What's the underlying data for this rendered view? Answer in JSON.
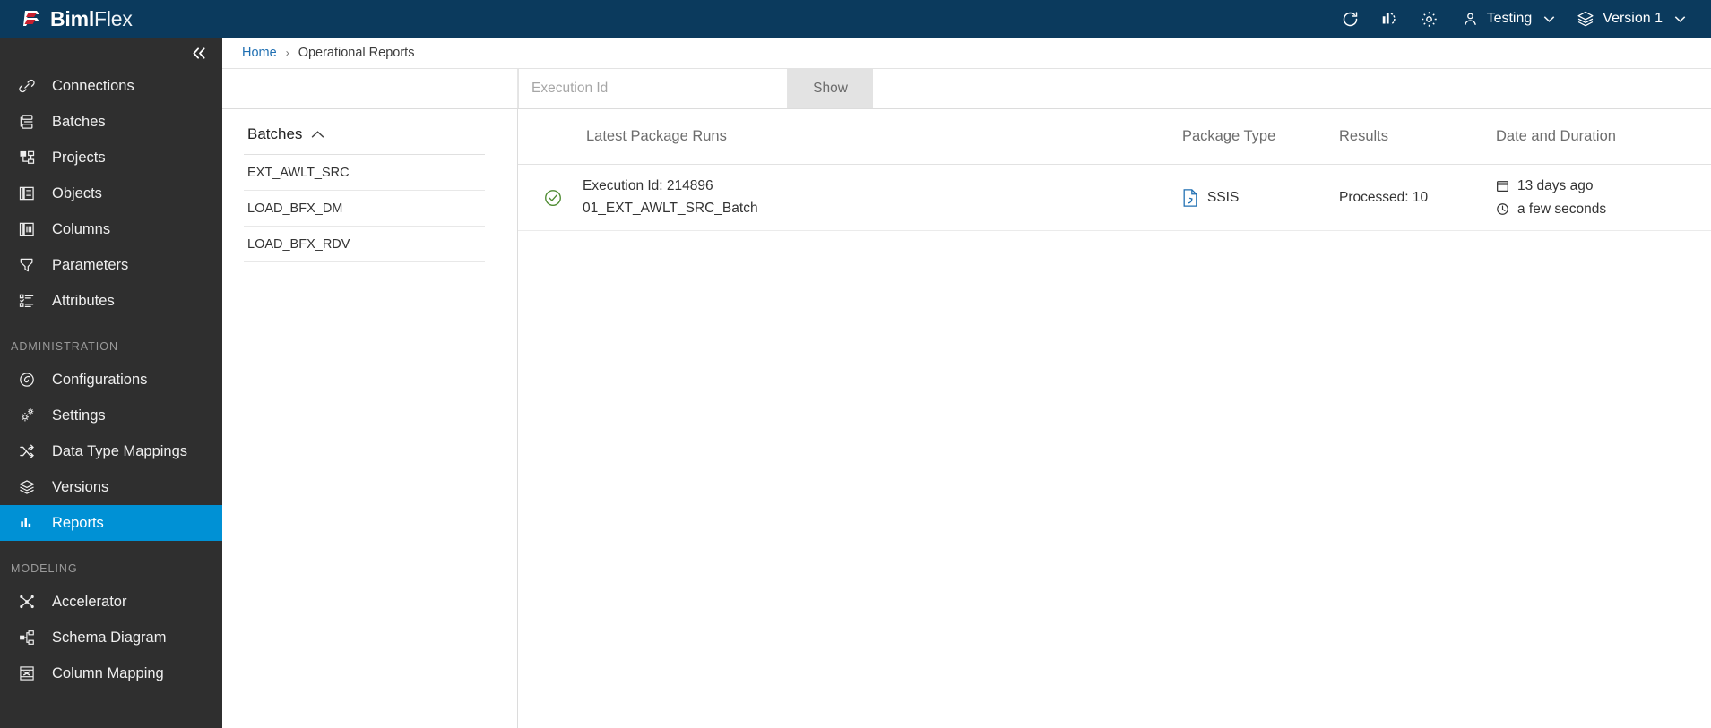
{
  "brand": {
    "name_bold": "Biml",
    "name_light": "Flex",
    "logo_icon": "bimlflex-logo-icon",
    "bar_color": "#0b3a5d",
    "accent_color": "#0091d5"
  },
  "topbar": {
    "icons": [
      {
        "name": "refresh-icon",
        "title": "Refresh"
      },
      {
        "name": "reports-chart-icon",
        "title": "Reports"
      },
      {
        "name": "gear-icon",
        "title": "Settings"
      }
    ],
    "user": {
      "icon": "user-icon",
      "label": "Testing",
      "caret": "⌄"
    },
    "version": {
      "icon": "layers-icon",
      "label": "Version 1",
      "caret": "⌄"
    }
  },
  "sidebar": {
    "collapse_icon": "double-chevron-left-icon",
    "collapse_glyph": "«",
    "items": [
      {
        "label": "Connections",
        "icon": "link-icon",
        "active": false
      },
      {
        "label": "Batches",
        "icon": "batches-icon",
        "active": false
      },
      {
        "label": "Projects",
        "icon": "projects-icon",
        "active": false
      },
      {
        "label": "Objects",
        "icon": "objects-icon",
        "active": false
      },
      {
        "label": "Columns",
        "icon": "columns-icon",
        "active": false
      },
      {
        "label": "Parameters",
        "icon": "parameters-icon",
        "active": false
      },
      {
        "label": "Attributes",
        "icon": "attributes-icon",
        "active": false
      }
    ],
    "sections": [
      {
        "title": "ADMINISTRATION",
        "items": [
          {
            "label": "Configurations",
            "icon": "configurations-icon",
            "active": false
          },
          {
            "label": "Settings",
            "icon": "settings-gear-icon",
            "active": false
          },
          {
            "label": "Data Type Mappings",
            "icon": "shuffle-icon",
            "active": false
          },
          {
            "label": "Versions",
            "icon": "layers-icon",
            "active": false
          },
          {
            "label": "Reports",
            "icon": "bar-chart-icon",
            "active": true
          }
        ]
      },
      {
        "title": "MODELING",
        "items": [
          {
            "label": "Accelerator",
            "icon": "accelerator-icon",
            "active": false
          },
          {
            "label": "Schema Diagram",
            "icon": "schema-diagram-icon",
            "active": false
          },
          {
            "label": "Column Mapping",
            "icon": "column-mapping-icon",
            "active": false
          }
        ]
      }
    ]
  },
  "breadcrumb": {
    "home": "Home",
    "separator": "›",
    "current": "Operational Reports"
  },
  "toolbar": {
    "execution_id_placeholder": "Execution Id",
    "execution_id_value": "",
    "show_label": "Show"
  },
  "batches_panel": {
    "title": "Batches",
    "caret": "^",
    "caret_icon": "chevron-up-icon",
    "items": [
      "EXT_AWLT_SRC",
      "LOAD_BFX_DM",
      "LOAD_BFX_RDV"
    ]
  },
  "runs_table": {
    "columns": {
      "runs": "Latest Package Runs",
      "type": "Package Type",
      "results": "Results",
      "date": "Date and Duration"
    },
    "rows": [
      {
        "status_icon": "check-circle-icon",
        "status_color": "#4e8b31",
        "execution_id_line": "Execution Id: 214896",
        "package_name": "01_EXT_AWLT_SRC_Batch",
        "package_type": "SSIS",
        "package_type_icon": "ssis-file-icon",
        "results": "Processed: 10",
        "date_icon": "calendar-icon",
        "date": "13 days ago",
        "duration_icon": "clock-icon",
        "duration": "a few seconds"
      }
    ]
  }
}
